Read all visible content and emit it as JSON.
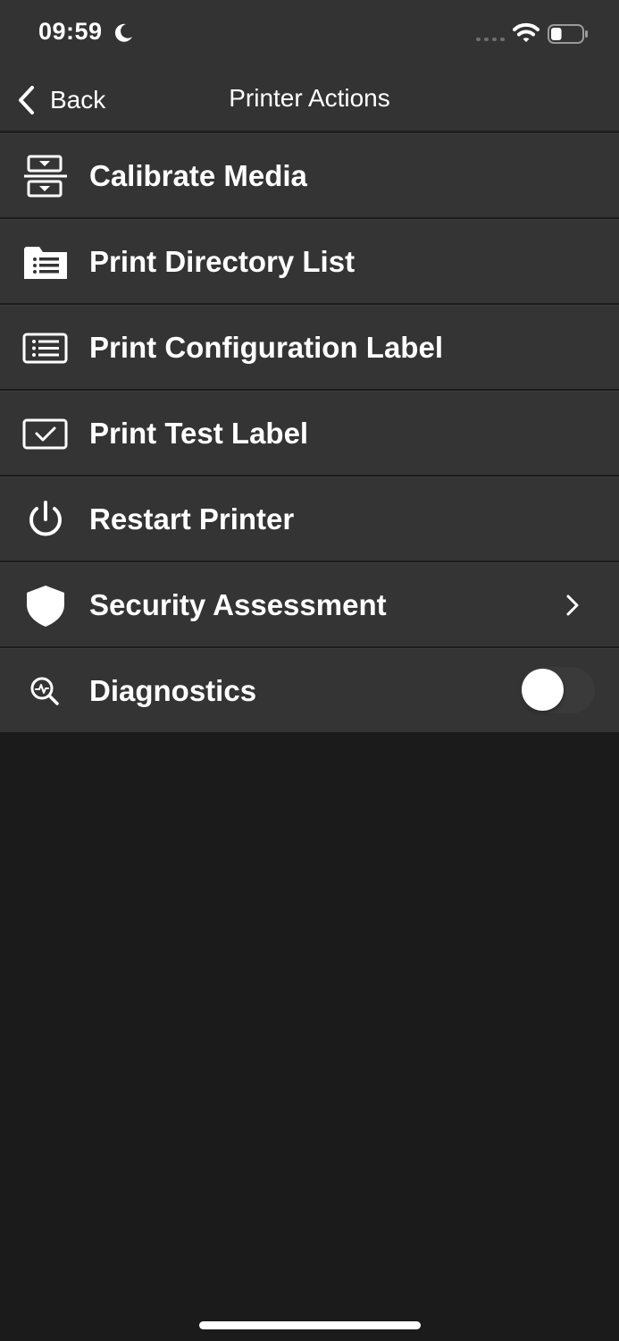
{
  "status_bar": {
    "time": "09:59",
    "moon_icon": "moon-icon",
    "signal_icon": "cellular-signal-icon",
    "wifi_icon": "wifi-icon",
    "battery_icon": "battery-icon",
    "battery_level": 0.35
  },
  "nav": {
    "back_label": "Back",
    "back_icon": "chevron-left-icon",
    "title": "Printer Actions"
  },
  "menu": {
    "items": [
      {
        "label": "Calibrate Media",
        "icon": "calibrate-icon"
      },
      {
        "label": "Print Directory List",
        "icon": "folder-list-icon"
      },
      {
        "label": "Print Configuration Label",
        "icon": "config-label-icon"
      },
      {
        "label": "Print Test Label",
        "icon": "test-label-icon"
      },
      {
        "label": "Restart Printer",
        "icon": "power-icon"
      },
      {
        "label": "Security Assessment",
        "icon": "shield-icon",
        "accessory": "chevron-right-icon"
      },
      {
        "label": "Diagnostics",
        "icon": "diagnostics-search-icon",
        "accessory": "toggle",
        "toggle_on": false
      }
    ]
  },
  "colors": {
    "background": "#1b1b1b",
    "header_bg": "#333333",
    "row_bg": "#343434",
    "text": "#ffffff",
    "toggle_off_track": "#3a3a3a"
  }
}
